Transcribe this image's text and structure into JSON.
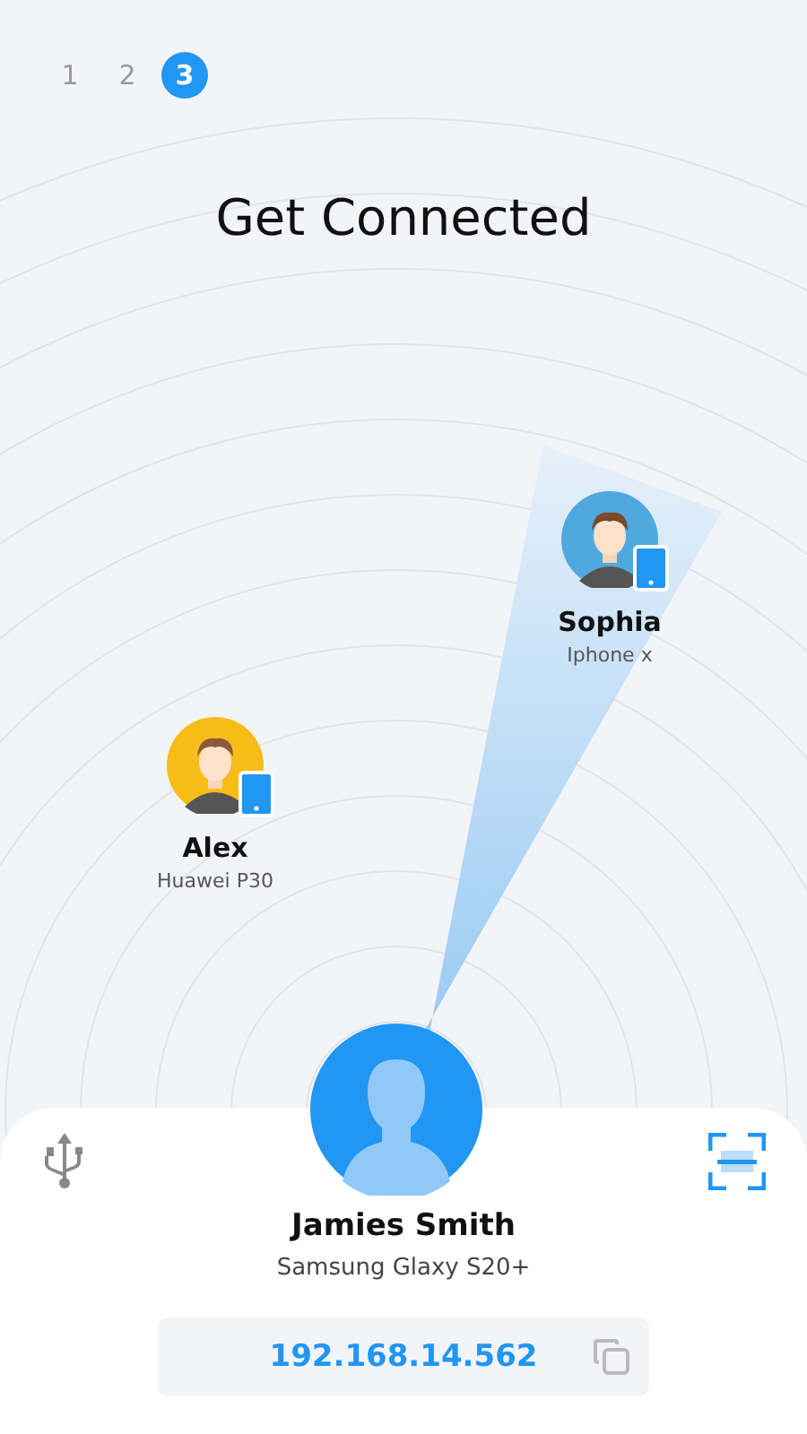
{
  "steps": [
    {
      "label": "1",
      "selected": false
    },
    {
      "label": "2",
      "selected": false
    },
    {
      "label": "3",
      "selected": true
    }
  ],
  "title": "Get Connected",
  "peers": [
    {
      "name": "Sophia",
      "device": "Iphone x",
      "color": "#4fa8e0"
    },
    {
      "name": "Alex",
      "device": "Huawei P30",
      "color": "#f7bd16"
    }
  ],
  "me": {
    "name": "Jamies Smith",
    "device": "Samsung Glaxy S20+",
    "address": "192.168.14.562"
  }
}
